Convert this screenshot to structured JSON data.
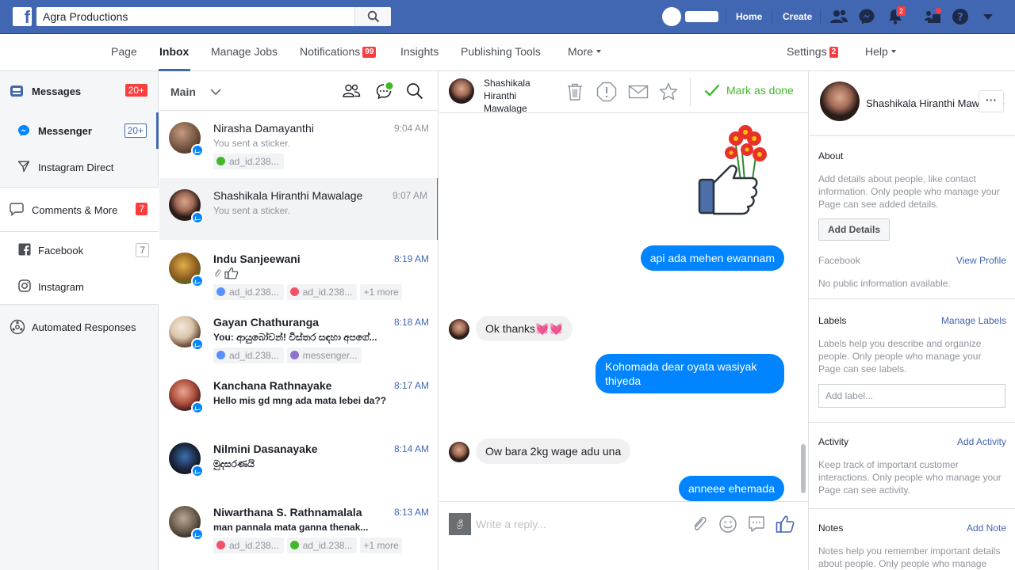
{
  "topbar": {
    "search_value": "Agra Productions",
    "home": "Home",
    "create": "Create",
    "notif_count": "2",
    "colors": {
      "bar": "#4267b2",
      "badge": "#fa3e3e"
    }
  },
  "pagenav": {
    "page": "Page",
    "inbox": "Inbox",
    "manage_jobs": "Manage Jobs",
    "notifications": "Notifications",
    "notifications_count": "99",
    "insights": "Insights",
    "publishing_tools": "Publishing Tools",
    "more": "More",
    "settings": "Settings",
    "settings_count": "2",
    "help": "Help"
  },
  "sidebar": {
    "messages": "Messages",
    "messages_count": "20+",
    "messenger": "Messenger",
    "messenger_count": "20+",
    "instagram_direct": "Instagram Direct",
    "comments_more": "Comments & More",
    "comments_count": "7",
    "facebook": "Facebook",
    "facebook_count": "7",
    "instagram": "Instagram",
    "automated": "Automated Responses"
  },
  "convlist": {
    "filter": "Main",
    "items": [
      {
        "name": "Nirasha Damayanthi",
        "time": "9:04 AM",
        "snippet": "You sent a sticker.",
        "tags": [
          {
            "label": "ad_id.238...",
            "color": "#42b72a"
          }
        ]
      },
      {
        "name": "Shashikala Hiranthi Mawalage",
        "time": "9:07 AM",
        "snippet": "You sent a sticker.",
        "tags": []
      },
      {
        "name": "Indu Sanjeewani",
        "time": "8:19 AM",
        "snippet": "",
        "tags": [
          {
            "label": "ad_id.238...",
            "color": "#5890ff"
          },
          {
            "label": "ad_id.238...",
            "color": "#f35369"
          }
        ],
        "more": "+1 more"
      },
      {
        "name": "Gayan Chathuranga",
        "time": "8:18 AM",
        "snippet": "You: ආයුබෝවන්! විස්තර සඳහා අපගේ...",
        "tags": [
          {
            "label": "ad_id.238...",
            "color": "#5890ff"
          },
          {
            "label": "messenger...",
            "color": "#8c72cb"
          }
        ]
      },
      {
        "name": "Kanchana Rathnayake",
        "time": "8:17 AM",
        "snippet": "Hello mis gd mng ada mata lebei da??",
        "tags": []
      },
      {
        "name": "Nilmini Dasanayake",
        "time": "8:14 AM",
        "snippet": "මුදසරණයි",
        "tags": []
      },
      {
        "name": "Niwarthana S. Rathnamalala",
        "time": "8:13 AM",
        "snippet": "man pannala mata ganna thenak...",
        "tags": [
          {
            "label": "ad_id.238...",
            "color": "#f35369"
          },
          {
            "label": "ad_id.238...",
            "color": "#42b72a"
          }
        ],
        "more": "+1 more"
      }
    ]
  },
  "chat": {
    "contact_name": "Shashikala Hiranthi Mawalage",
    "mark_done": "Mark as done",
    "messages": [
      {
        "dir": "out",
        "text": "api ada mehen ewannam"
      },
      {
        "dir": "in",
        "text": "Ok thanks💓💓"
      },
      {
        "dir": "out",
        "text": "Kohomada dear oyata wasiyak thiyeda"
      },
      {
        "dir": "in",
        "text": "Ow bara 2kg wage adu una"
      },
      {
        "dir": "out",
        "text": "anneee ehemada"
      }
    ],
    "reply_placeholder": "Write a reply...",
    "reply_avatar_text": "ශ්‍රී"
  },
  "rpanel": {
    "name": "Shashikala Hiranthi Mawalage",
    "more": "···",
    "about_title": "About",
    "about_text": "Add details about people, like contact information. Only people who manage your Page can see added details.",
    "add_details": "Add Details",
    "facebook_title": "Facebook",
    "view_profile": "View Profile",
    "facebook_text": "No public information available.",
    "labels_title": "Labels",
    "manage_labels": "Manage Labels",
    "labels_text": "Labels help you describe and organize people. Only people who manage your Page can see labels.",
    "add_label_placeholder": "Add label...",
    "activity_title": "Activity",
    "add_activity": "Add Activity",
    "activity_text": "Keep track of important customer interactions. Only people who manage your Page can see activity.",
    "notes_title": "Notes",
    "add_note": "Add Note",
    "notes_text": "Notes help you remember important details about people. Only people who manage"
  }
}
